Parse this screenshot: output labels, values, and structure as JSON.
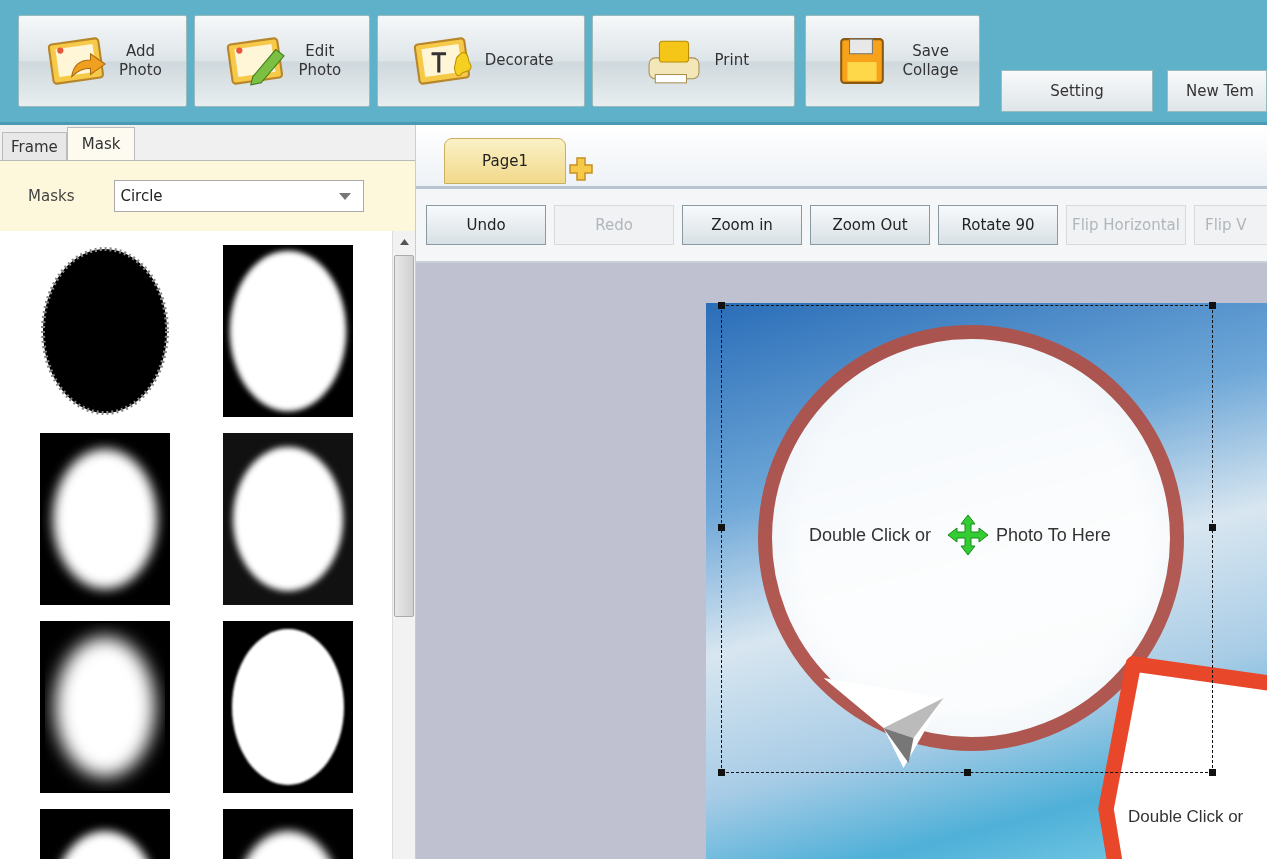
{
  "toolbar": {
    "buttons": [
      {
        "kind": "add-photo",
        "label": "Add\nPhoto"
      },
      {
        "kind": "edit-photo",
        "label": "Edit\nPhoto"
      },
      {
        "kind": "decorate",
        "label": "Decorate"
      },
      {
        "kind": "print",
        "label": "Print"
      },
      {
        "kind": "save",
        "label": "Save\nCollage"
      }
    ],
    "small_buttons": [
      "Setting",
      "New Tem"
    ]
  },
  "side_panel": {
    "tabs": [
      {
        "label": "Frame",
        "selected": false
      },
      {
        "label": "Mask",
        "selected": true
      }
    ],
    "masks_label": "Masks",
    "masks_value": "Circle",
    "mask_thumbnails": [
      {
        "kind": "rough"
      },
      {
        "kind": "spiky"
      },
      {
        "kind": "soft"
      },
      {
        "kind": "grunge"
      },
      {
        "kind": "blur"
      },
      {
        "kind": "sharp"
      },
      {
        "kind": "top"
      },
      {
        "kind": "top"
      }
    ]
  },
  "page_tabs": [
    {
      "label": "Page1",
      "selected": true
    }
  ],
  "edit_toolbar": [
    {
      "label": "Undo",
      "disabled": false
    },
    {
      "label": "Redo",
      "disabled": true
    },
    {
      "label": "Zoom in",
      "disabled": false
    },
    {
      "label": "Zoom Out",
      "disabled": false
    },
    {
      "label": "Rotate 90",
      "disabled": false
    },
    {
      "label": "Flip Horizontal",
      "disabled": true
    },
    {
      "label": "Flip V",
      "disabled": true
    }
  ],
  "canvas": {
    "circle_text_left": "Double Click or",
    "circle_text_right": "Photo To Here",
    "frame_text": "Double Click or"
  }
}
